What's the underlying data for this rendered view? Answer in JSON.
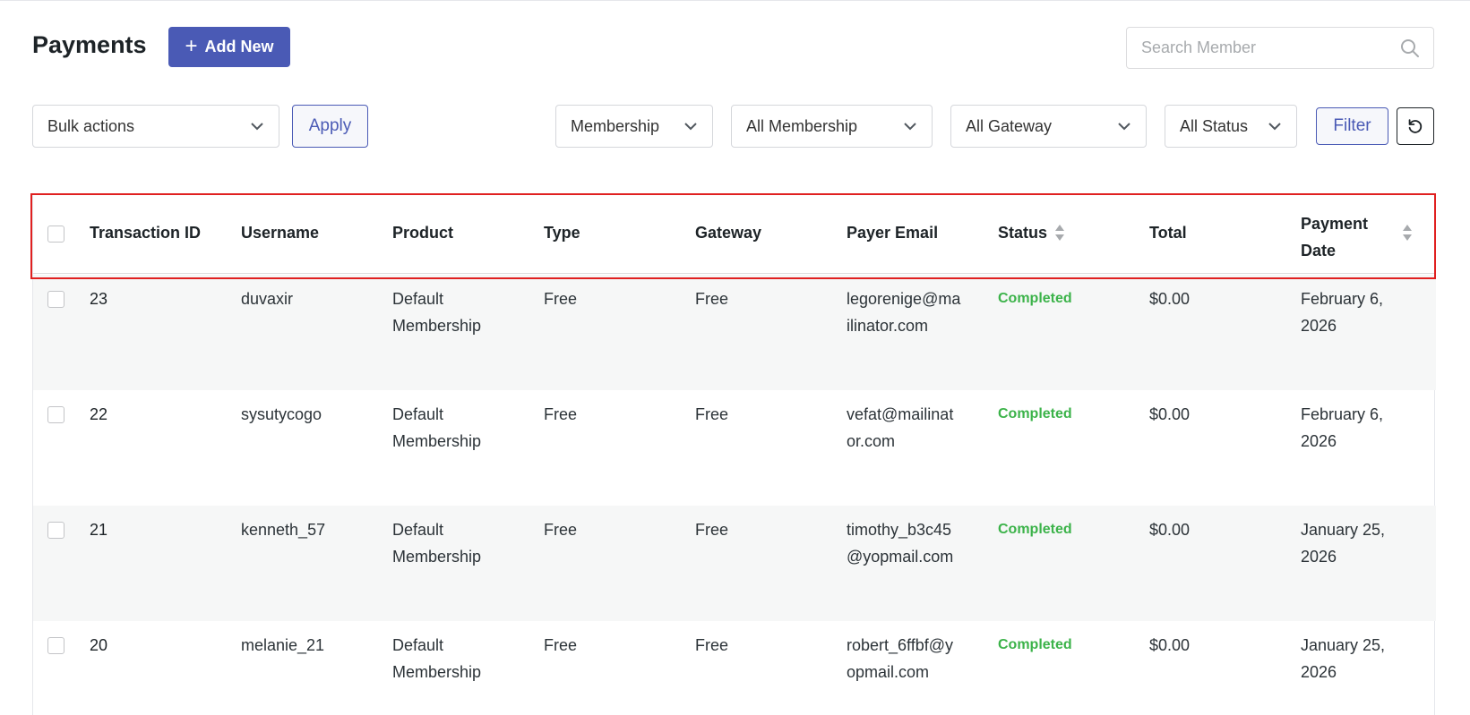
{
  "header": {
    "title": "Payments",
    "add_new_label": "Add New",
    "search_placeholder": "Search Member"
  },
  "filters": {
    "bulk_actions": "Bulk actions",
    "apply_label": "Apply",
    "membership": "Membership",
    "all_membership": "All Membership",
    "all_gateway": "All Gateway",
    "all_status": "All Status",
    "filter_label": "Filter"
  },
  "table": {
    "columns": {
      "transaction_id": "Transaction ID",
      "username": "Username",
      "product": "Product",
      "type": "Type",
      "gateway": "Gateway",
      "payer_email": "Payer Email",
      "status": "Status",
      "total": "Total",
      "payment_date_1": "Payment",
      "payment_date_2": "Date"
    },
    "rows": [
      {
        "id": "23",
        "username": "duvaxir",
        "product_1": "Default",
        "product_2": "Membership",
        "type": "Free",
        "gateway": "Free",
        "email_1": "legorenige@ma",
        "email_2": "ilinator.com",
        "status": "Completed",
        "total": "$0.00",
        "date_1": "February 6,",
        "date_2": "2026"
      },
      {
        "id": "22",
        "username": "sysutycogo",
        "product_1": "Default",
        "product_2": "Membership",
        "type": "Free",
        "gateway": "Free",
        "email_1": "vefat@mailinat",
        "email_2": "or.com",
        "status": "Completed",
        "total": "$0.00",
        "date_1": "February 6,",
        "date_2": "2026"
      },
      {
        "id": "21",
        "username": "kenneth_57",
        "product_1": "Default",
        "product_2": "Membership",
        "type": "Free",
        "gateway": "Free",
        "email_1": "timothy_b3c45",
        "email_2": "@yopmail.com",
        "status": "Completed",
        "total": "$0.00",
        "date_1": "January 25,",
        "date_2": "2026"
      },
      {
        "id": "20",
        "username": "melanie_21",
        "product_1": "Default",
        "product_2": "Membership",
        "type": "Free",
        "gateway": "Free",
        "email_1": "robert_6ffbf@y",
        "email_2": "opmail.com",
        "status": "Completed",
        "total": "$0.00",
        "date_1": "January 25,",
        "date_2": "2026"
      }
    ]
  },
  "colors": {
    "accent": "#4a5ab5",
    "status_completed": "#3cb34a",
    "highlight_border": "#e02020"
  },
  "icons": {
    "search": "search-icon",
    "chevron": "chevron-down-icon",
    "reset": "reset-icon",
    "plus": "plus-icon",
    "sort": "sort-icon"
  }
}
